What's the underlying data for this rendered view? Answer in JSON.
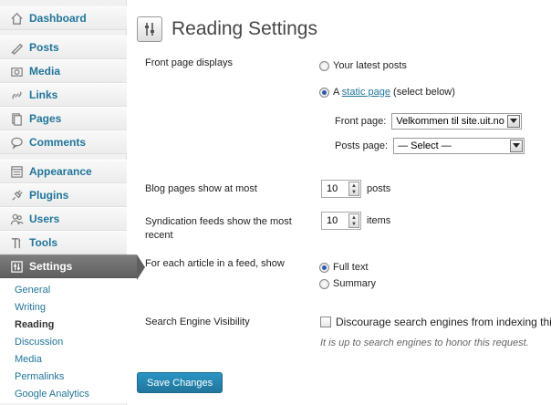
{
  "sidebar": {
    "items": [
      {
        "label": "Dashboard",
        "icon": "dashboard-icon"
      },
      {
        "label": "Posts",
        "icon": "posts-icon"
      },
      {
        "label": "Media",
        "icon": "media-icon"
      },
      {
        "label": "Links",
        "icon": "links-icon"
      },
      {
        "label": "Pages",
        "icon": "pages-icon"
      },
      {
        "label": "Comments",
        "icon": "comments-icon"
      },
      {
        "label": "Appearance",
        "icon": "appearance-icon"
      },
      {
        "label": "Plugins",
        "icon": "plugins-icon"
      },
      {
        "label": "Users",
        "icon": "users-icon"
      },
      {
        "label": "Tools",
        "icon": "tools-icon"
      },
      {
        "label": "Settings",
        "icon": "settings-icon"
      }
    ],
    "submenu": [
      "General",
      "Writing",
      "Reading",
      "Discussion",
      "Media",
      "Permalinks",
      "Google Analytics"
    ]
  },
  "page": {
    "title": "Reading Settings"
  },
  "form": {
    "front_page_label": "Front page displays",
    "latest_posts_label": "Your latest posts",
    "static_prefix": "A ",
    "static_link": "static page",
    "static_suffix": " (select below)",
    "front_page_select_label": "Front page:",
    "front_page_select_value": "Velkommen til site.uit.no",
    "posts_page_select_label": "Posts page:",
    "posts_page_select_value": "— Select —",
    "blog_pages_label": "Blog pages show at most",
    "blog_pages_value": "10",
    "blog_pages_unit": "posts",
    "feeds_label_line1": "Syndication feeds show the most",
    "feeds_label_line2": "recent",
    "feeds_value": "10",
    "feeds_unit": "items",
    "article_feed_label": "For each article in a feed, show",
    "full_text_label": "Full text",
    "summary_label": "Summary",
    "visibility_label": "Search Engine Visibility",
    "discourage_label": "Discourage search engines from indexing this site",
    "visibility_hint": "It is up to search engines to honor this request.",
    "save_label": "Save Changes"
  },
  "colors": {
    "link": "#21759b",
    "current_menu": "#6d6d6d",
    "button": "#21759b"
  }
}
